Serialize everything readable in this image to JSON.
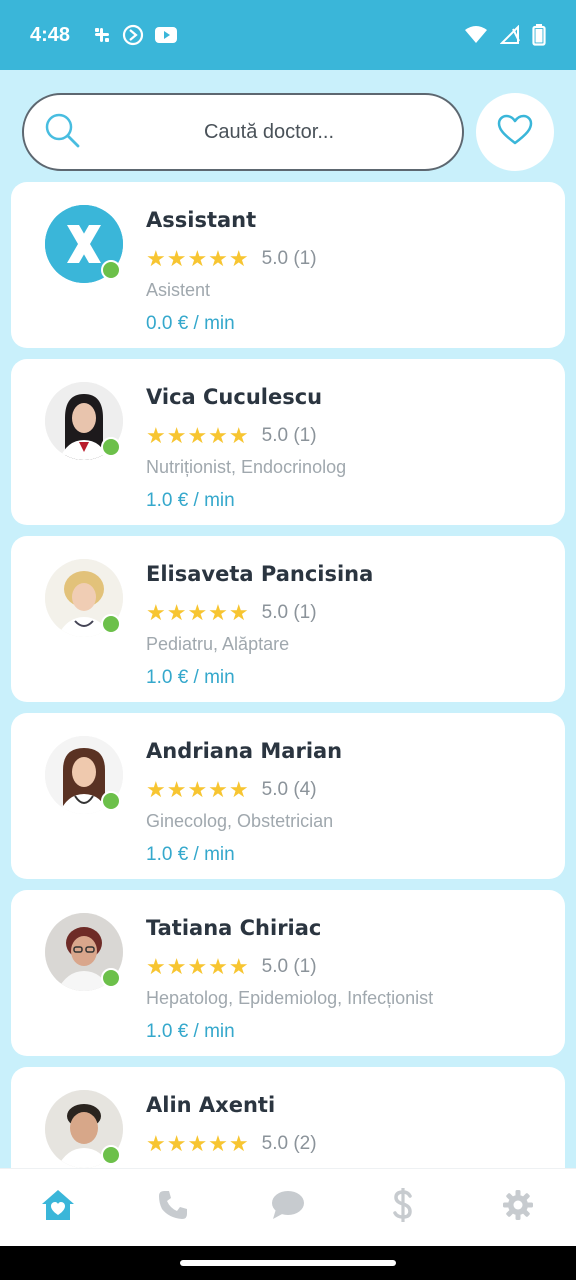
{
  "status_bar": {
    "time": "4:48",
    "left_icons": [
      "slack-icon",
      "sync-icon",
      "youtube-icon"
    ],
    "right_icons": [
      "wifi-icon",
      "signal-icon",
      "battery-icon"
    ]
  },
  "search": {
    "placeholder": "Caută doctor...",
    "icon": "search-icon",
    "favorites_icon": "heart-icon"
  },
  "colors": {
    "accent": "#3ab6d9",
    "background": "#c9f0fb",
    "star": "#f7c531",
    "online": "#6cc04a",
    "price": "#35a8cc"
  },
  "doctors": [
    {
      "name": "Assistant",
      "stars": "★★★★★",
      "rating": "5.0 (1)",
      "specialty": "Asistent",
      "price": "0.0 € / min",
      "online": true
    },
    {
      "name": "Vica Cuculescu",
      "stars": "★★★★★",
      "rating": "5.0 (1)",
      "specialty": "Nutriționist, Endocrinolog",
      "price": "1.0 € / min",
      "online": true
    },
    {
      "name": "Elisaveta Pancisina",
      "stars": "★★★★★",
      "rating": "5.0 (1)",
      "specialty": "Pediatru, Alăptare",
      "price": "1.0 € / min",
      "online": true
    },
    {
      "name": "Andriana Marian",
      "stars": "★★★★★",
      "rating": "5.0 (4)",
      "specialty": "Ginecolog, Obstetrician",
      "price": "1.0 € / min",
      "online": true
    },
    {
      "name": "Tatiana Chiriac",
      "stars": "★★★★★",
      "rating": "5.0 (1)",
      "specialty": "Hepatolog, Epidemiolog, Infecționist",
      "price": "1.0 € / min",
      "online": true
    },
    {
      "name": "Alin Axenti",
      "stars": "★★★★★",
      "rating": "5.0 (2)",
      "specialty": "",
      "price": "",
      "online": true
    }
  ],
  "bottom_nav": [
    {
      "icon": "home-heart-icon",
      "active": true
    },
    {
      "icon": "phone-icon",
      "active": false
    },
    {
      "icon": "chat-icon",
      "active": false
    },
    {
      "icon": "dollar-icon",
      "active": false
    },
    {
      "icon": "gear-icon",
      "active": false
    }
  ]
}
